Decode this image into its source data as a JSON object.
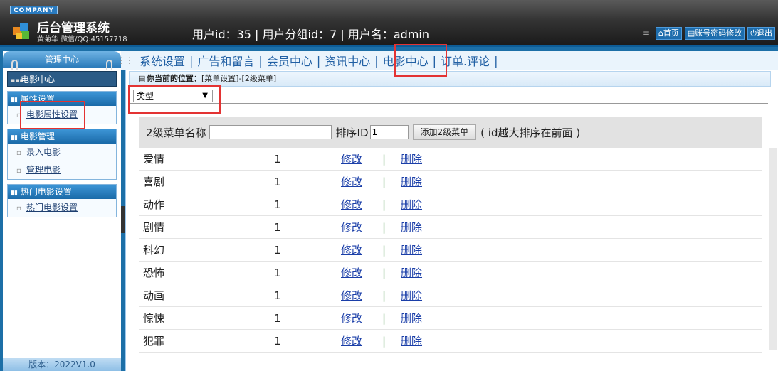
{
  "header": {
    "company": "COMPANY",
    "title": "后台管理系统",
    "subtitle": "黄菊华 微信/QQ:45157718",
    "user_info": "用户id：35 | 用户分组id：7 | 用户名：admin",
    "links": [
      "首页",
      "账号密码修改",
      "退出"
    ]
  },
  "sidebar": {
    "top_label": "管理中心",
    "current": "电影中心",
    "groups": [
      {
        "title": "属性设置",
        "items": [
          "电影属性设置"
        ]
      },
      {
        "title": "电影管理",
        "items": [
          "录入电影",
          "管理电影"
        ]
      },
      {
        "title": "热门电影设置",
        "items": [
          "热门电影设置"
        ]
      }
    ],
    "version": "版本：2022V1.0"
  },
  "topnav": {
    "items": [
      "系统设置",
      "广告和留言",
      "会员中心",
      "资讯中心",
      "电影中心",
      "订单.评论"
    ],
    "separator": "|"
  },
  "main": {
    "position_label": "你当前的位置：",
    "position_path": "[菜单设置]-[2级菜单]",
    "type_select": "类型",
    "form": {
      "name_label": "2级菜单名称",
      "name_value": "",
      "sort_label": "排序ID",
      "sort_value": "1",
      "add_button": "添加2级菜单",
      "hint": "( id越大排序在前面 )"
    },
    "rows": [
      {
        "name": "爱情",
        "sort": "1",
        "edit": "修改",
        "sep": "|",
        "del": "删除"
      },
      {
        "name": "喜剧",
        "sort": "1",
        "edit": "修改",
        "sep": "|",
        "del": "删除"
      },
      {
        "name": "动作",
        "sort": "1",
        "edit": "修改",
        "sep": "|",
        "del": "删除"
      },
      {
        "name": "剧情",
        "sort": "1",
        "edit": "修改",
        "sep": "|",
        "del": "删除"
      },
      {
        "name": "科幻",
        "sort": "1",
        "edit": "修改",
        "sep": "|",
        "del": "删除"
      },
      {
        "name": "恐怖",
        "sort": "1",
        "edit": "修改",
        "sep": "|",
        "del": "删除"
      },
      {
        "name": "动画",
        "sort": "1",
        "edit": "修改",
        "sep": "|",
        "del": "删除"
      },
      {
        "name": "惊悚",
        "sort": "1",
        "edit": "修改",
        "sep": "|",
        "del": "删除"
      },
      {
        "name": "犯罪",
        "sort": "1",
        "edit": "修改",
        "sep": "|",
        "del": "删除"
      }
    ]
  },
  "colors": {
    "brand": "#1c6fa7",
    "highlight": "#e33333",
    "link": "#1a3ea8"
  }
}
